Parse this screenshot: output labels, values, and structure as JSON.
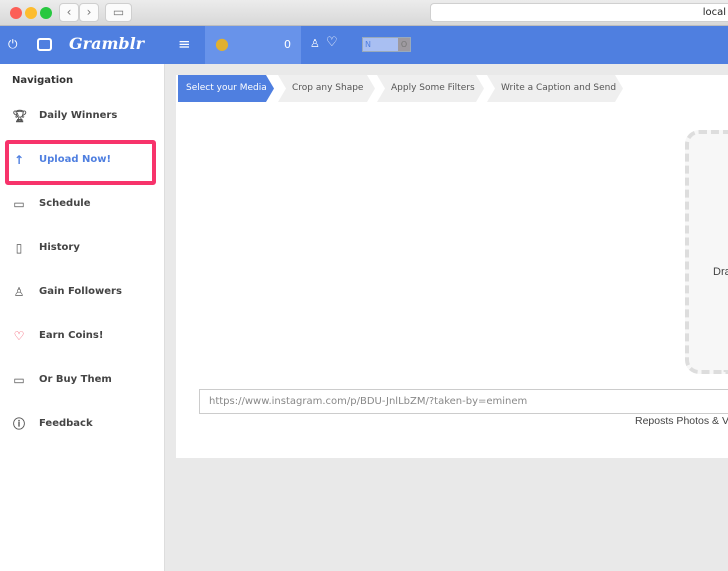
{
  "browser": {
    "url": "local"
  },
  "topbar": {
    "brand": "Gramblr",
    "coins": "0",
    "toggle_on": "N",
    "toggle_off": "O",
    "accent": "#4f7fe0"
  },
  "sidebar": {
    "title": "Navigation",
    "items": [
      {
        "label": "Daily Winners",
        "icon": "trophy-icon"
      },
      {
        "label": "Upload Now!",
        "icon": "upload-icon"
      },
      {
        "label": "Schedule",
        "icon": "calendar-icon"
      },
      {
        "label": "History",
        "icon": "book-icon"
      },
      {
        "label": "Gain Followers",
        "icon": "user-icon"
      },
      {
        "label": "Earn Coins!",
        "icon": "heart-icon"
      },
      {
        "label": "Or Buy Them",
        "icon": "wallet-icon"
      },
      {
        "label": "Feedback",
        "icon": "question-icon"
      }
    ],
    "highlight_color": "#f7336b"
  },
  "steps": [
    "Select your Media",
    "Crop any Shape",
    "Apply Some Filters",
    "Write a Caption and Send"
  ],
  "main": {
    "drop_text": "Dra",
    "url_placeholder": "https://www.instagram.com/p/BDU-JnlLbZM/?taken-by=eminem",
    "repost_text": "Reposts Photos & V"
  }
}
